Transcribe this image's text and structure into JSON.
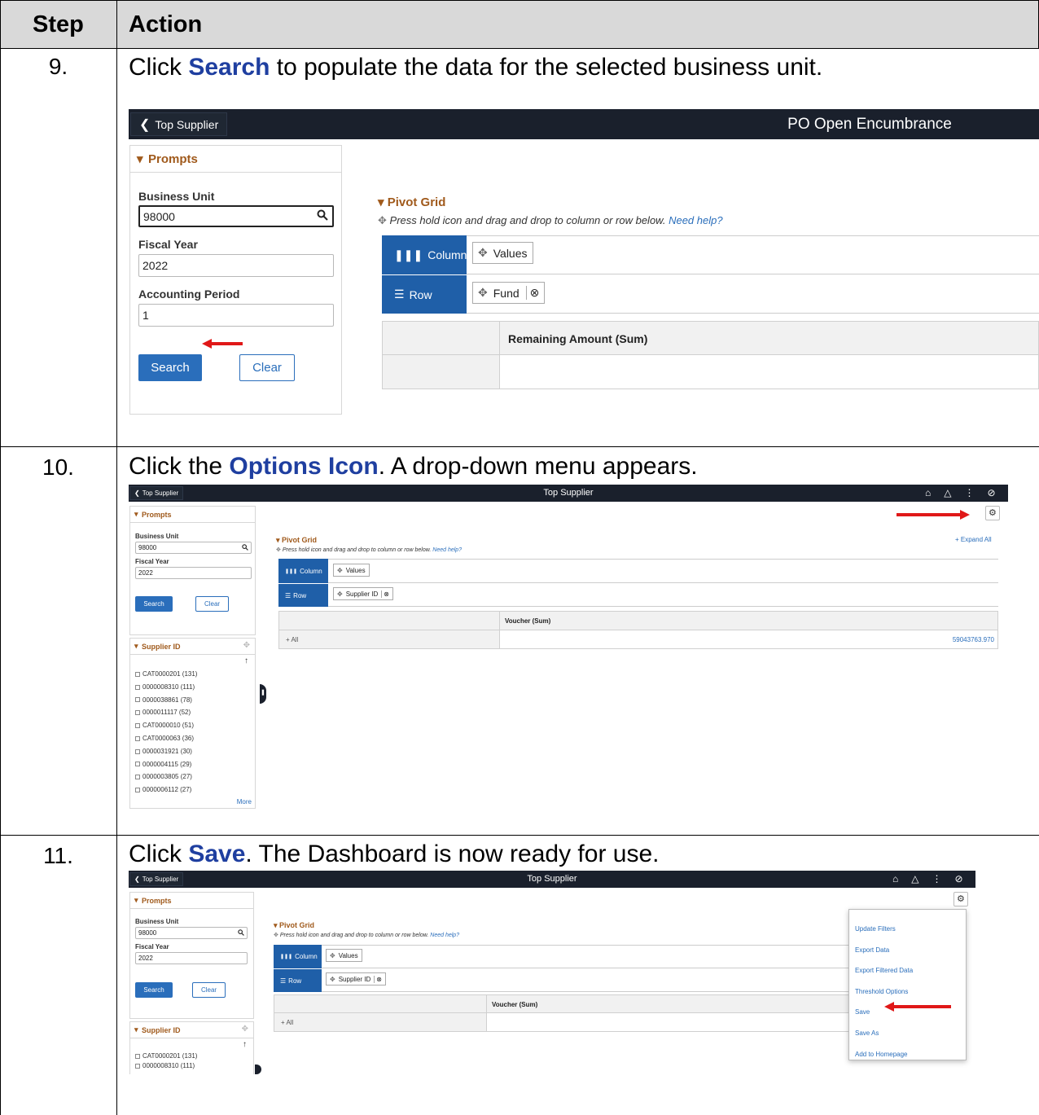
{
  "header": {
    "step": "Step",
    "action": "Action"
  },
  "steps": [
    {
      "num": "9.",
      "pre": "Click ",
      "bold": "Search",
      "post": " to populate the data for the selected business unit.",
      "screen": {
        "back_label": "Top Supplier",
        "title": "PO Open Encumbrance",
        "prompts_title": "Prompts",
        "business_unit_label": "Business Unit",
        "business_unit_value": "98000",
        "fiscal_year_label": "Fiscal Year",
        "fiscal_year_value": "2022",
        "acct_period_label": "Accounting Period",
        "acct_period_value": "1",
        "search_label": "Search",
        "clear_label": "Clear",
        "pivot_title": "Pivot Grid",
        "hint": "Press hold icon and drag and drop to column or row below.",
        "help_link": "Need help?",
        "column_label": "Column",
        "row_label": "Row",
        "column_chip": "Values",
        "row_chip": "Fund",
        "table_header": "Remaining Amount (Sum)"
      }
    },
    {
      "num": "10.",
      "pre": "Click the ",
      "bold": "Options Icon",
      "post": ". A drop-down menu appears.",
      "screen": {
        "back_label": "Top Supplier",
        "title": "Top Supplier",
        "prompts_title": "Prompts",
        "business_unit_label": "Business Unit",
        "business_unit_value": "98000",
        "fiscal_year_label": "Fiscal Year",
        "fiscal_year_value": "2022",
        "search_label": "Search",
        "clear_label": "Clear",
        "supplier_title": "Supplier ID",
        "suppliers": [
          "CAT0000201 (131)",
          "0000008310 (111)",
          "0000038861 (78)",
          "0000011117 (52)",
          "CAT0000010 (51)",
          "CAT0000063 (36)",
          "0000031921 (30)",
          "0000004115 (29)",
          "0000003805 (27)",
          "0000006112 (27)"
        ],
        "more_label": "More",
        "pivot_title": "Pivot Grid",
        "expand_all": "+ Expand All",
        "hint": "Press hold icon and drag and drop to column or row below.",
        "help_link": "Need help?",
        "column_label": "Column",
        "row_label": "Row",
        "column_chip": "Values",
        "row_chip": "Supplier ID",
        "table_header": "Voucher (Sum)",
        "all_label": "+ All",
        "total_value": "59043763.970"
      }
    },
    {
      "num": "11.",
      "pre": "Click ",
      "bold": "Save",
      "post": ". The Dashboard is now ready for use.",
      "screen": {
        "back_label": "Top Supplier",
        "title": "Top Supplier",
        "prompts_title": "Prompts",
        "business_unit_label": "Business Unit",
        "business_unit_value": "98000",
        "fiscal_year_label": "Fiscal Year",
        "fiscal_year_value": "2022",
        "search_label": "Search",
        "clear_label": "Clear",
        "supplier_title": "Supplier ID",
        "suppliers": [
          "CAT0000201 (131)",
          "0000008310 (111)"
        ],
        "pivot_title": "Pivot Grid",
        "hint": "Press hold icon and drag and drop to column or row below.",
        "help_link": "Need help?",
        "column_label": "Column",
        "row_label": "Row",
        "column_chip": "Values",
        "row_chip": "Supplier ID",
        "table_header": "Voucher (Sum)",
        "all_label": "+ All",
        "menu": [
          "Update Filters",
          "Export Data",
          "Export Filtered Data",
          "Threshold Options",
          "Save",
          "Save As",
          "Add to Homepage"
        ]
      }
    }
  ],
  "colors": {
    "accent": "#1f3fa0",
    "arrow": "#e01818",
    "topbar": "#1a202c",
    "button": "#2a6ebb",
    "prompt_heading": "#a05a1c"
  }
}
